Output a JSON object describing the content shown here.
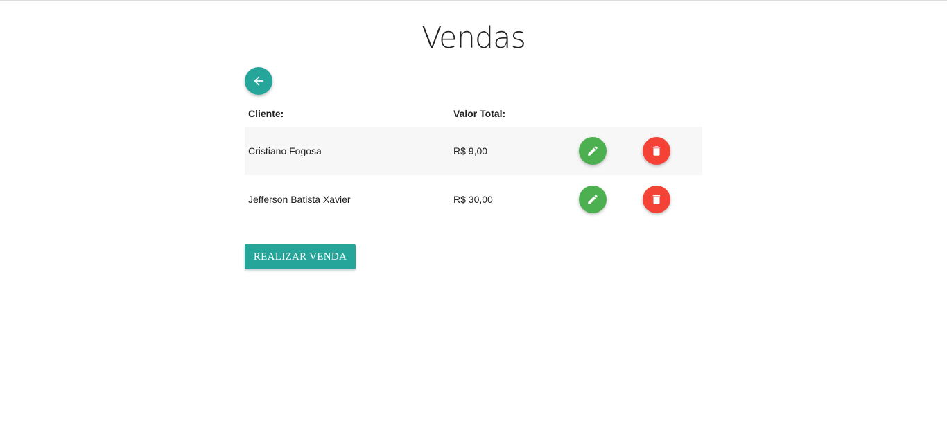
{
  "page": {
    "title": "Vendas"
  },
  "nav": {
    "back_icon": "arrow-left-icon"
  },
  "table": {
    "headers": {
      "client": "Cliente:",
      "total": "Valor Total:"
    },
    "rows": [
      {
        "client": "Cristiano Fogosa",
        "total": "R$ 9,00"
      },
      {
        "client": "Jefferson Batista Xavier",
        "total": "R$ 30,00"
      }
    ],
    "edit_icon": "pencil-icon",
    "delete_icon": "trash-icon"
  },
  "actions": {
    "primary_label": "REALIZAR VENDA"
  },
  "colors": {
    "accent": "#26a69a",
    "edit": "#4caf50",
    "delete": "#f44336",
    "stripe": "#f7f7f7"
  }
}
